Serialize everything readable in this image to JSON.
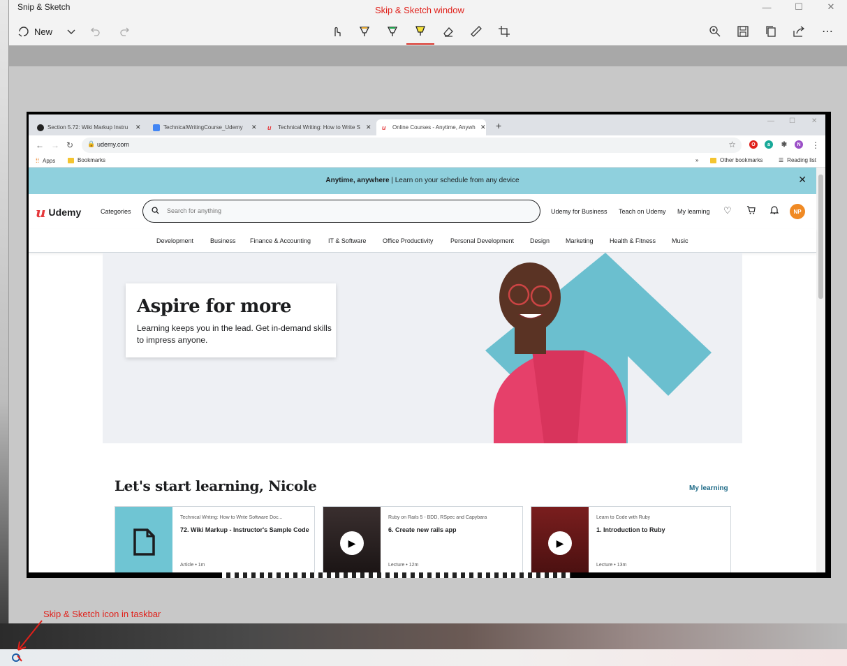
{
  "snip_window": {
    "title": "Snip & Sketch",
    "new_label": "New",
    "controls": {
      "minimize": "—",
      "maximize": "☐",
      "close": "✕"
    }
  },
  "annotations": {
    "window_label": "Skip & Sketch window",
    "taskbar_label": "Skip & Sketch icon in taskbar"
  },
  "browser": {
    "tabs": [
      {
        "label": "Section 5.72: Wiki Markup Instru",
        "icon": "github-icon"
      },
      {
        "label": "TechnicalWritingCourse_Udemy",
        "icon": "google-docs-icon"
      },
      {
        "label": "Technical Writing: How to Write S",
        "icon": "udemy-icon"
      },
      {
        "label": "Online Courses - Anytime, Anywh",
        "icon": "udemy-icon",
        "active": true
      }
    ],
    "url": "udemy.com",
    "bookmarks": {
      "apps": "Apps",
      "bookmarks": "Bookmarks",
      "more": "»",
      "other": "Other bookmarks",
      "reading_list": "Reading list"
    },
    "extensions": [
      {
        "label": "O",
        "color": "#e0201a"
      },
      {
        "label": "a",
        "color": "#18a999"
      },
      {
        "label": "N",
        "color": "#9b4fc7"
      }
    ]
  },
  "udemy": {
    "banner": {
      "bold": "Anytime, anywhere",
      "text": " | Learn on your schedule from any device",
      "close": "✕"
    },
    "logo": "Udemy",
    "categories_label": "Categories",
    "search_placeholder": "Search for anything",
    "header_links": {
      "business": "Udemy for Business",
      "teach": "Teach on Udemy",
      "my_learning": "My learning"
    },
    "avatar_initials": "NP",
    "categories": [
      "Development",
      "Business",
      "Finance & Accounting",
      "IT & Software",
      "Office Productivity",
      "Personal Development",
      "Design",
      "Marketing",
      "Health & Fitness",
      "Music"
    ],
    "hero": {
      "title": "Aspire for more",
      "text": "Learning keeps you in the lead. Get in-demand skills to impress anyone."
    },
    "greeting": "Let's start learning, Nicole",
    "my_learning_link": "My learning",
    "courses": [
      {
        "course": "Technical Writing: How to Write Software Doc...",
        "title": "72. Wiki Markup - Instructor's Sample Code",
        "meta": "Article • 1m",
        "thumb": "article"
      },
      {
        "course": "Ruby on Rails 5 - BDD, RSpec and Capybara",
        "title": "6. Create new rails app",
        "meta": "Lecture • 12m",
        "thumb": "video-dark"
      },
      {
        "course": "Learn to Code with Ruby",
        "title": "1. Introduction to Ruby",
        "meta": "Lecture • 13m",
        "thumb": "video-red"
      }
    ]
  },
  "colors": {
    "accent_red": "#e0201a",
    "teal": "#6bbfcf",
    "udemy_red": "#e5383b"
  }
}
